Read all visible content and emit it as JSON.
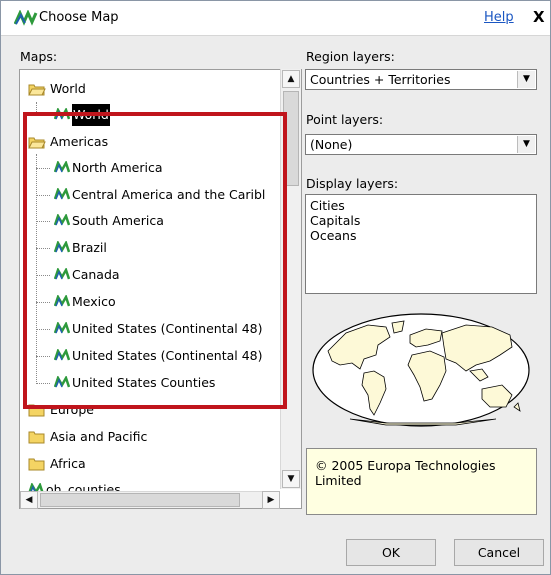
{
  "window": {
    "title": "Choose Map",
    "help_label": "Help",
    "close_label": "X"
  },
  "maps_panel": {
    "label": "Maps:",
    "items": [
      {
        "label": "World",
        "kind": "folder-open"
      },
      {
        "label": "World",
        "kind": "map",
        "selected": true
      },
      {
        "label": "Americas",
        "kind": "folder-open"
      },
      {
        "label": "North America",
        "kind": "map"
      },
      {
        "label": "Central America and the Caribl",
        "kind": "map"
      },
      {
        "label": "South America",
        "kind": "map"
      },
      {
        "label": "Brazil",
        "kind": "map"
      },
      {
        "label": "Canada",
        "kind": "map"
      },
      {
        "label": "Mexico",
        "kind": "map"
      },
      {
        "label": "United States (Continental 48)",
        "kind": "map"
      },
      {
        "label": "United States (Continental 48)",
        "kind": "map"
      },
      {
        "label": "United States Counties",
        "kind": "map"
      },
      {
        "label": "Europe",
        "kind": "folder"
      },
      {
        "label": "Asia and Pacific",
        "kind": "folder"
      },
      {
        "label": "Africa",
        "kind": "folder"
      },
      {
        "label": "oh_counties",
        "kind": "map"
      }
    ]
  },
  "region_layers": {
    "label": "Region layers:",
    "value": "Countries + Territories"
  },
  "point_layers": {
    "label": "Point layers:",
    "value": "(None)"
  },
  "display_layers": {
    "label": "Display layers:",
    "items": [
      "Cities",
      "Capitals",
      "Oceans"
    ]
  },
  "copyright": "© 2005 Europa Technologies Limited",
  "buttons": {
    "ok": "OK",
    "cancel": "Cancel"
  },
  "colors": {
    "highlight": "#c0151c",
    "link": "#1a56c2",
    "info_bg": "#ffffe1",
    "map_icon_blue": "#1f5fb0",
    "map_icon_green": "#2e9a3c",
    "folder": "#f4d463"
  }
}
